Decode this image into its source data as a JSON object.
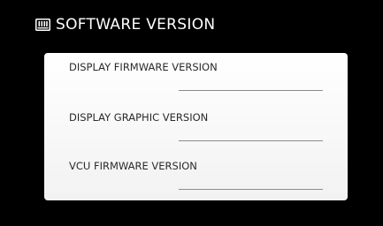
{
  "header": {
    "icon": "firmware-chip-icon",
    "title": "SOFTWARE VERSION"
  },
  "versions": [
    {
      "label": "DISPLAY FIRMWARE VERSION",
      "value": ""
    },
    {
      "label": "DISPLAY GRAPHIC VERSION",
      "value": ""
    },
    {
      "label": "VCU FIRMWARE VERSION",
      "value": ""
    }
  ],
  "colors": {
    "background": "#000000",
    "panel": "#ffffff",
    "title": "#ffffff"
  }
}
